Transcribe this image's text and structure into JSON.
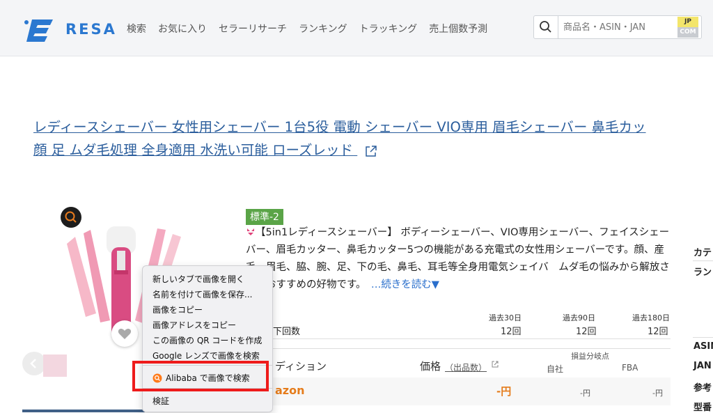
{
  "header": {
    "logo_text": "RESA",
    "nav": [
      "検索",
      "お気に入り",
      "セラーリサーチ",
      "ランキング",
      "トラッキング",
      "売上個数予測"
    ],
    "search": {
      "placeholder": "商品名・ASIN・JAN",
      "value": ""
    },
    "locale": {
      "top": "JP",
      "bottom": "COM"
    }
  },
  "product": {
    "title_line1": "レディースシェーバー 女性用シェーバー 1台5役 電動 シェーバー VIO専用 眉毛シェーバー 鼻毛カッ",
    "title_line2": "顔 足 ムダ毛処理 全身適用 水洗い可能 ローズレッド",
    "badge": "標準-2",
    "description": "【5in1レディースシェーバー】 ボディーシェーバー、VIO専用シェーバー、フェイスシェーバー、眉毛カッター、鼻毛カッター5つの機能がある充電式の女性用シェーバーです。顔、産毛、眉毛、脇、腕、足、下の毛、鼻毛、耳毛等全身用電気シェイバ　ムダ毛の悩みから解放させるおすすめの好物です。",
    "readmore": "…続きを読む▼"
  },
  "sidebar": {
    "labels": [
      "カテ",
      "ラン",
      "ASIN",
      "JAN",
      "参考",
      "型番"
    ]
  },
  "ranking": {
    "periods": [
      "過去30日",
      "過去90日",
      "過去180日"
    ],
    "label": "ング降下回数",
    "counts": [
      "12回",
      "12回",
      "12回"
    ]
  },
  "offers": {
    "col_condition": "ディション",
    "col_price": "価格",
    "col_sellers": "（出品数）",
    "breakeven": "損益分岐点",
    "col_self": "自社",
    "col_fba": "FBA",
    "seller": "azon",
    "price": "-円",
    "self_price": "-円",
    "fba_price": "-円"
  },
  "context_menu": {
    "items": [
      "新しいタブで画像を開く",
      "名前を付けて画像を保存...",
      "画像をコピー",
      "画像アドレスをコピー",
      "この画像の QR コードを作成",
      "Google レンズで画像を検索"
    ],
    "extension_item": "Alibaba で画像で検索",
    "inspect": "検証"
  },
  "colors": {
    "accent": "#2b78d0",
    "highlight": "#ee1b1b",
    "badge": "#5aa447",
    "price": "#e57c1b"
  }
}
